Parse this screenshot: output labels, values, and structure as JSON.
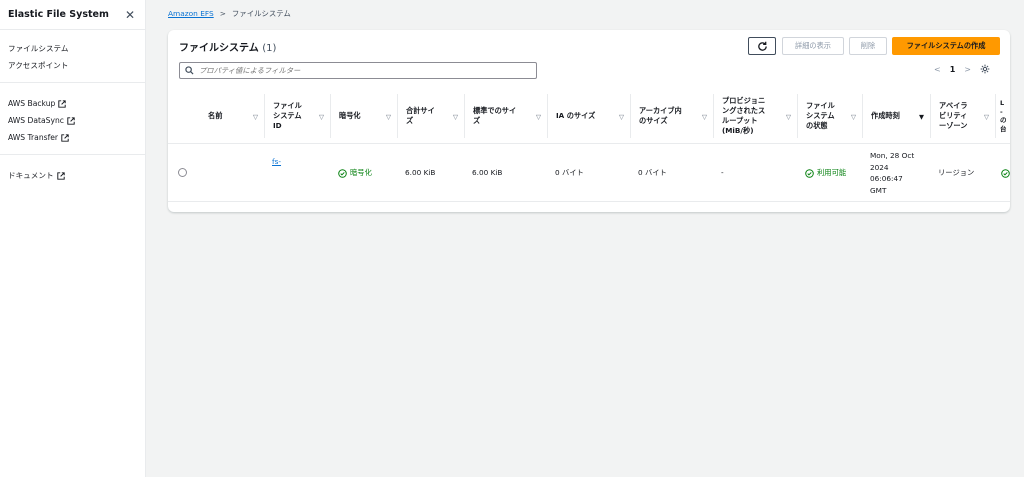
{
  "sidebar": {
    "title": "Elastic File System",
    "nav": [
      "ファイルシステム",
      "アクセスポイント"
    ],
    "external": [
      "AWS Backup",
      "AWS DataSync",
      "AWS Transfer"
    ],
    "docs": "ドキュメント"
  },
  "breadcrumb": {
    "root": "Amazon EFS",
    "sep": ">",
    "current": "ファイルシステム"
  },
  "panel": {
    "title": "ファイルシステム",
    "count": "(1)",
    "buttons": {
      "details": "詳細の表示",
      "delete": "削除",
      "create": "ファイルシステムの作成"
    },
    "filter_placeholder": "プロパティ値によるフィルター",
    "pagination": {
      "prev": "<",
      "page": "1",
      "next": ">"
    }
  },
  "table": {
    "headers": [
      "名前",
      "ファイル\nシステム\nID",
      "暗号化",
      "合計サイ\nズ",
      "標準でのサイ\nズ",
      "IA のサイズ",
      "アーカイブ内\nのサイズ",
      "プロビジョニ\nングされたス\nループット\n(MiB/秒)",
      "ファイル\nシステム\nの状態",
      "作成時刻",
      "アベイラ\nビリティ\nーゾーン",
      "L\n-\nの\n台"
    ],
    "row": {
      "name": "",
      "id": "fs-",
      "encryption": "暗号化",
      "total_size": "6.00 KiB",
      "standard_size": "6.00 KiB",
      "ia_size": "0 バイト",
      "archive_size": "0 バイト",
      "throughput": "-",
      "state": "利用可能",
      "created": "Mon, 28 Oct\n2024\n06:06:47\nGMT",
      "az": "リージョン"
    }
  },
  "colors": {
    "accent": "#ff9900",
    "link": "#0972d3",
    "success": "#037f0c"
  }
}
